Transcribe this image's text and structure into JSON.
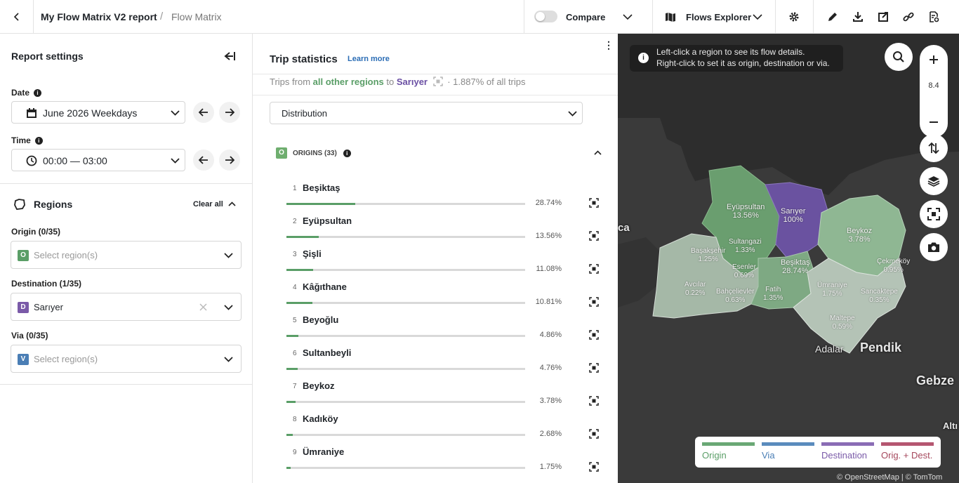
{
  "header": {
    "report_title": "My Flow Matrix V2 report",
    "separator": "/",
    "page_name": "Flow Matrix",
    "compare_label": "Compare",
    "explorer_label": "Flows Explorer"
  },
  "settings": {
    "title": "Report settings",
    "date_label": "Date",
    "date_value": "June 2026 Weekdays",
    "time_label": "Time",
    "time_value": "00:00 — 03:00",
    "regions_title": "Regions",
    "clear_all": "Clear all",
    "origin_label": "Origin (0/35)",
    "origin_badge": "O",
    "origin_placeholder": "Select region(s)",
    "destination_label": "Destination (1/35)",
    "destination_badge": "D",
    "destination_value": "Sarıyer",
    "via_label": "Via (0/35)",
    "via_badge": "V",
    "via_placeholder": "Select region(s)"
  },
  "stats": {
    "title": "Trip statistics",
    "learn_more": "Learn more",
    "trips_from": "Trips from",
    "from_value": "all other regions",
    "to": "to",
    "to_value": "Sarıyer",
    "share": "· 1.887% of all trips",
    "view_select": "Distribution",
    "origins_badge": "O",
    "origins_label": "ORIGINS (33)",
    "rows": [
      {
        "rank": "1",
        "name": "Beşiktaş",
        "pct": "28.74%",
        "value": 28.74
      },
      {
        "rank": "2",
        "name": "Eyüpsultan",
        "pct": "13.56%",
        "value": 13.56
      },
      {
        "rank": "3",
        "name": "Şişli",
        "pct": "11.08%",
        "value": 11.08
      },
      {
        "rank": "4",
        "name": "Kâğıthane",
        "pct": "10.81%",
        "value": 10.81
      },
      {
        "rank": "5",
        "name": "Beyoğlu",
        "pct": "4.86%",
        "value": 4.86
      },
      {
        "rank": "6",
        "name": "Sultanbeyli",
        "pct": "4.76%",
        "value": 4.76
      },
      {
        "rank": "7",
        "name": "Beykoz",
        "pct": "3.78%",
        "value": 3.78
      },
      {
        "rank": "8",
        "name": "Kadıköy",
        "pct": "2.68%",
        "value": 2.68
      },
      {
        "rank": "9",
        "name": "Ümraniye",
        "pct": "1.75%",
        "value": 1.75
      }
    ]
  },
  "map": {
    "tip_line1": "Left-click a region to see its flow details.",
    "tip_line2": "Right-click to set it as origin, destination or via.",
    "zoom_level": "8.4",
    "labels": {
      "eyup": "Eyüpsultan\n13.56%",
      "sariyer": "Sarıyer\n100%",
      "beykoz": "Beykoz\n3.78%",
      "basak": "Başakşehir\n1.25%",
      "sultangazi": "Sultangazi\n1.33%",
      "esenler": "Esenler\n0.69%",
      "besiktas": "Beşiktaş\n28.74%",
      "cekmekoy": "Çekmeköy\n0.95%",
      "umraniye": "Ümraniye\n1.75%",
      "sancaktepe": "Sancaktepe\n0.35%",
      "avcilar": "Avcılar\n0.22%",
      "bahcelievler": "Bahçelievler\n0.63%",
      "fatih": "Fatih\n1.35%",
      "maltepe": "Maltepe\n0.59%"
    },
    "places": {
      "ca": "ca",
      "adalar": "Adalar",
      "pendik": "Pendik",
      "gebze": "Gebze",
      "alti": "Altı"
    },
    "legend": {
      "origin": "Origin",
      "via": "Via",
      "destination": "Destination",
      "orig_dest": "Orig. + Dest."
    },
    "attribution": "© OpenStreetMap | © TomTom",
    "colors": {
      "origin": "#5a9e67",
      "via": "#4a7eb5",
      "destination": "#7a5aa8",
      "orig_dest": "#a5475c"
    }
  }
}
